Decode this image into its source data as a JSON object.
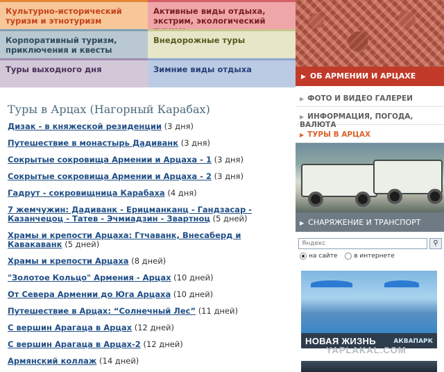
{
  "categories": [
    {
      "label": "Культурно-исторический туризм и этнотуризм"
    },
    {
      "label": "Активные виды отдыха, экстрим, экологический туризм"
    },
    {
      "label": "Корпоративный туризм, приключения и квесты"
    },
    {
      "label": "Внедорожные туры"
    },
    {
      "label": "Туры выходного дня"
    },
    {
      "label": "Зимние виды отдыха"
    }
  ],
  "main": {
    "title": "Туры в Арцах (Нагорный Карабах)",
    "tours": [
      {
        "name": "Дизак - в княжеской резиденции",
        "days": "(3 дня)"
      },
      {
        "name": "Путешествие в монастырь Дадиванк",
        "days": "(3 дня)"
      },
      {
        "name": "Сокрытые сокровища Армении и Арцаха - 1",
        "days": "(3 дня)"
      },
      {
        "name": "Сокрытые сокровища Армении и Арцаха - 2",
        "days": "(3 дня)"
      },
      {
        "name": "Гадрут - сокровищница Карабаха",
        "days": "(4 дня)"
      },
      {
        "name": "7 жемчужин: Дадиванк - Ерицманканц - Гандзасар - Казанчецоц - Татев - Эчмиадзин - Звартноц",
        "days": "(5 дней)"
      },
      {
        "name": "Храмы и крепости Арцаха: Гтчаванк, Внесаберд и Кавакаванк",
        "days": "(5 дней)"
      },
      {
        "name": "Храмы и крепости Арцаха",
        "days": "(8 дней)"
      },
      {
        "name": "\"Золотое Кольцо\" Армения - Арцах",
        "days": "(10 дней)"
      },
      {
        "name": "От Севера Армении до Юга Арцаха",
        "days": "(10 дней)"
      },
      {
        "name": "Путешествие в Арцах: “Солнечный Лес”",
        "days": "(11 дней)"
      },
      {
        "name": "С вершин Арагаца в Арцах",
        "days": "(12 дней)"
      },
      {
        "name": "С вершин Арагаца в Арцах-2",
        "days": "(12 дней)"
      },
      {
        "name": "Армянский коллаж",
        "days": "(14 дней)"
      }
    ]
  },
  "sidebar": {
    "nav_primary": "ОБ АРМЕНИИ И АРЦАХЕ",
    "nav_items": [
      "ФОТО И ВИДЕО ГАЛЕРЕИ",
      "ИНФОРМАЦИЯ, ПОГОДА, ВАЛЮТА",
      "ТУРЫ В АРЦАХ"
    ],
    "nav_equipment": "СНАРЯЖЕНИЕ И ТРАНСПОРТ",
    "search": {
      "placeholder": "Яндекс",
      "button_icon": "search-icon"
    },
    "radios": [
      {
        "label": "на сайте",
        "checked": true
      },
      {
        "label": "в интернете",
        "checked": false
      }
    ],
    "ad": {
      "title": "НОВАЯ ЖИЗНЬ",
      "subtitle": "АКВАПАРК"
    }
  },
  "watermark": "YAPLAKAL.COM",
  "colors": {
    "accent_red": "#c23a2a",
    "active_orange": "#d8632a",
    "link_blue": "#1f4e86"
  }
}
